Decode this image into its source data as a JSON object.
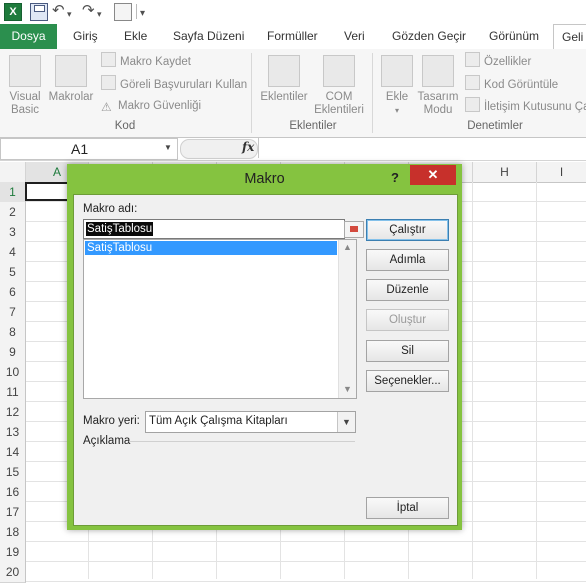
{
  "qat": {
    "app_icon": "X",
    "undo": "↶",
    "redo": "↷",
    "more": "▾"
  },
  "tabs": [
    {
      "label": "Dosya"
    },
    {
      "label": "Giriş"
    },
    {
      "label": "Ekle"
    },
    {
      "label": "Sayfa Düzeni"
    },
    {
      "label": "Formüller"
    },
    {
      "label": "Veri"
    },
    {
      "label": "Gözden Geçir"
    },
    {
      "label": "Görünüm"
    },
    {
      "label": "Geli"
    }
  ],
  "ribbon": {
    "visual_basic": "Visual\nBasic",
    "macros": "Makrolar",
    "record_macro": "Makro Kaydet",
    "relative_refs": "Göreli Başvuruları Kullan",
    "macro_security": "Makro Güvenliği",
    "group_code": "Kod",
    "addins": "Eklentiler",
    "com_addins": "COM\nEklentileri",
    "group_addins": "Eklentiler",
    "insert": "Ekle",
    "design_mode": "Tasarım\nModu",
    "properties": "Özellikler",
    "view_code": "Kod Görüntüle",
    "run_dialog": "İletişim Kutusunu Ça",
    "group_controls": "Denetimler"
  },
  "formula_bar": {
    "name_box": "A1",
    "fx": "fx"
  },
  "grid": {
    "columns": [
      "A",
      "H",
      "I"
    ],
    "rows": [
      "1",
      "2",
      "3",
      "4",
      "5",
      "6",
      "7",
      "8",
      "9",
      "10",
      "11",
      "12",
      "13",
      "14",
      "15",
      "16",
      "17",
      "18",
      "19",
      "20"
    ]
  },
  "dialog": {
    "title": "Makro",
    "help": "?",
    "close": "✕",
    "name_label": "Makro adı:",
    "name_value": "SatişTablosu",
    "macros": [
      "SatişTablosu"
    ],
    "buttons": {
      "run": "Çalıştır",
      "step": "Adımla",
      "edit": "Düzenle",
      "create": "Oluştur",
      "delete": "Sil",
      "options": "Seçenekler..."
    },
    "location_label": "Makro yeri:",
    "location_value": "Tüm Açık Çalışma Kitapları",
    "description_label": "Açıklama",
    "cancel": "İptal"
  },
  "colors": {
    "file_tab": "#2b8f4e",
    "dialog_frame": "#85c340",
    "close_button": "#c7302b",
    "selection": "#3399ff"
  }
}
